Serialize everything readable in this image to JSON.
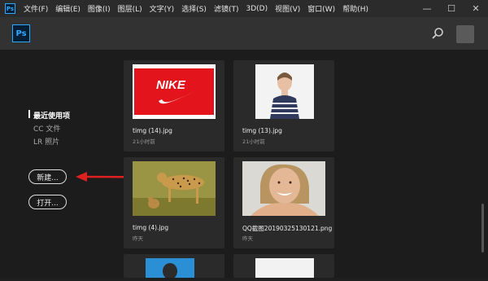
{
  "titlebar": {
    "app_icon": "Ps",
    "menu": [
      "文件(F)",
      "编辑(E)",
      "图像(I)",
      "图层(L)",
      "文字(Y)",
      "选择(S)",
      "滤镜(T)",
      "3D(D)",
      "视图(V)",
      "窗口(W)",
      "帮助(H)"
    ],
    "minimize": "—",
    "maximize": "☐",
    "close": "✕"
  },
  "header": {
    "logo": "Ps",
    "search_icon": "search-icon",
    "avatar_icon": "avatar"
  },
  "nav": {
    "recent": "最近使用项",
    "cc_files": "CC 文件",
    "lr_photos": "LR 照片"
  },
  "buttons": {
    "new": "新建...",
    "open": "打开..."
  },
  "files": [
    {
      "name": "timg (14).jpg",
      "time": "21小时前"
    },
    {
      "name": "timg (13).jpg",
      "time": "21小时前"
    },
    {
      "name": "timg (4).jpg",
      "time": "昨天"
    },
    {
      "name": "QQ截图20190325130121.png",
      "time": "昨天"
    }
  ],
  "thumb_text": {
    "nike": "NIKE"
  },
  "colors": {
    "accent": "#31a8ff",
    "arrow": "#e02020",
    "nike_red": "#e3141b"
  }
}
